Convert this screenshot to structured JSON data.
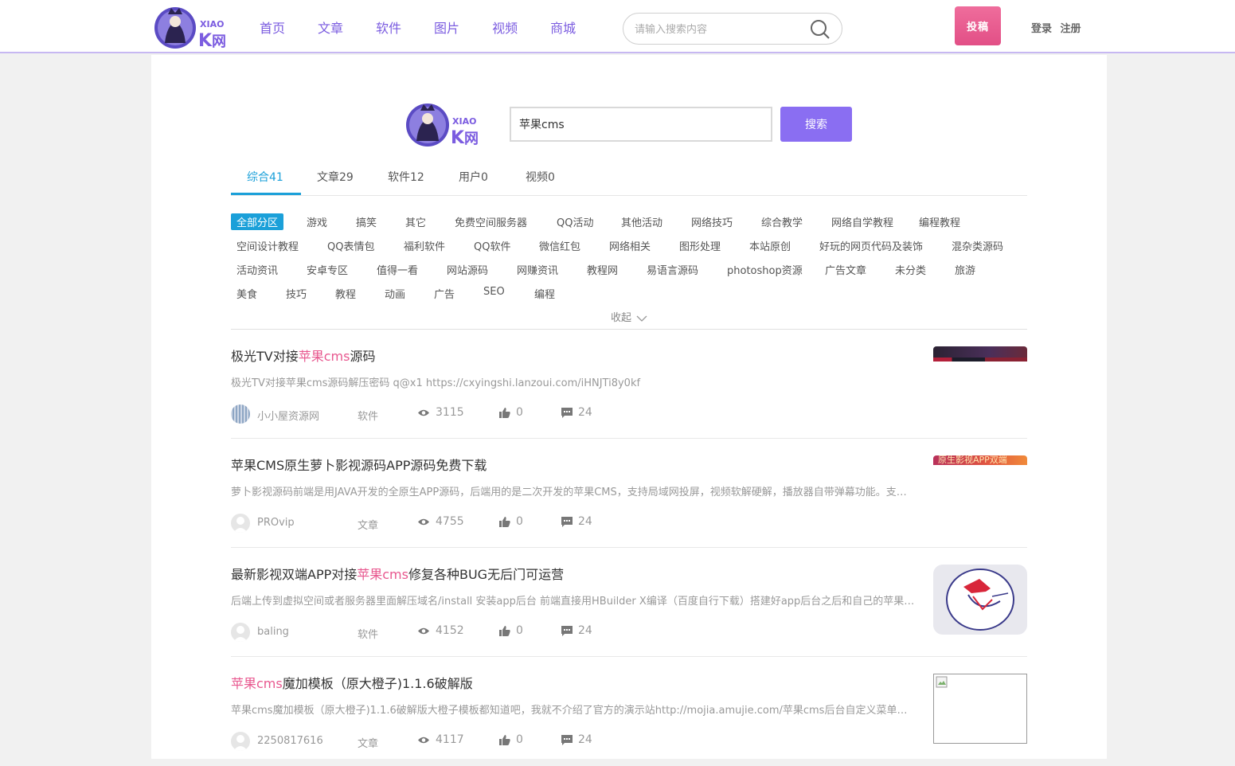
{
  "header": {
    "logo_text": "XIAO K网",
    "nav": [
      "首页",
      "文章",
      "软件",
      "图片",
      "视频",
      "商城"
    ],
    "search_placeholder": "请输入搜索内容",
    "submit_label": "投稿",
    "login": "登录",
    "register": "注册"
  },
  "search": {
    "query": "苹果cms",
    "button": "搜索"
  },
  "tabs": [
    {
      "label": "综合",
      "count": "41",
      "active": true
    },
    {
      "label": "文章",
      "count": "29"
    },
    {
      "label": "软件",
      "count": "12"
    },
    {
      "label": "用户",
      "count": "0"
    },
    {
      "label": "视频",
      "count": "0"
    }
  ],
  "categories": [
    [
      "全部分区",
      "游戏",
      "搞笑",
      "其它",
      "免费空间服务器",
      "QQ活动",
      "其他活动",
      "网络技巧",
      "综合教学",
      "网络自学教程",
      "编程教程"
    ],
    [
      "空间设计教程",
      "QQ表情包",
      "福利软件",
      "QQ软件",
      "微信红包",
      "网络相关",
      "图形处理",
      "本站原创",
      "好玩的网页代码及装饰",
      "混杂类源码"
    ],
    [
      "活动资讯",
      "安卓专区",
      "值得一看",
      "网站源码",
      "网赚资讯",
      "教程网",
      "易语言源码",
      "photoshop资源",
      "广告文章",
      "未分类",
      "旅游"
    ],
    [
      "美食",
      "技巧",
      "教程",
      "动画",
      "广告",
      "SEO",
      "编程"
    ]
  ],
  "collapse_label": "收起",
  "results": [
    {
      "title_pre": "极光TV对接",
      "title_hl": "苹果cms",
      "title_post": "源码",
      "desc": "极光TV对接苹果cms源码解压密码 q@x1 https://cxyingshi.lanzoui.com/iHNJTi8y0kf",
      "author": "小小屋资源网",
      "type": "软件",
      "views": "3115",
      "likes": "0",
      "comments": "24"
    },
    {
      "title_pre": "苹果CMS原生萝卜影视源码APP源码免费下载",
      "title_hl": "",
      "title_post": "",
      "desc": "萝卜影视源码前端是用JAVA开发的全原生APP源码，后端用的是二次开发的苹果CMS，支持局域网投屏，视频软解硬解，播放器自带弹幕功能。支持各种类型视频播放，功能齐全。",
      "author": "PROvip",
      "type": "文章",
      "views": "4755",
      "likes": "0",
      "comments": "24",
      "thumb_text": "原生影视APP双端"
    },
    {
      "title_pre": "最新影视双端APP对接",
      "title_hl": "苹果cms",
      "title_post": "修复各种BUG无后门可运营",
      "desc": "后端上传到虚拟空间或者服务器里面解压域名/install 安装app后台 前端直接用HBuilder X编译（百度自行下载）搭建好app后台之后和自己的苹果cms对接即可。",
      "author": "baling",
      "type": "软件",
      "views": "4152",
      "likes": "0",
      "comments": "24"
    },
    {
      "title_pre": "",
      "title_hl": "苹果cms",
      "title_post": "魔加模板（原大橙子)1.1.6破解版",
      "desc": "苹果cms魔加模板（原大橙子)1.1.6破解版大橙子模板都知道吧，我就不介绍了官方的演示站http://mojia.amujie.com/苹果cms后台自定义菜单：主题设置,mojia/admin/theme/index。",
      "author": "2250817616",
      "type": "文章",
      "views": "4117",
      "likes": "0",
      "comments": "24"
    }
  ],
  "colors": {
    "accent": "#8a6ef2",
    "nav": "#7b5ce0",
    "highlight": "#e8588f",
    "tab_active": "#1ba0d9",
    "submit": "#e24f86"
  }
}
